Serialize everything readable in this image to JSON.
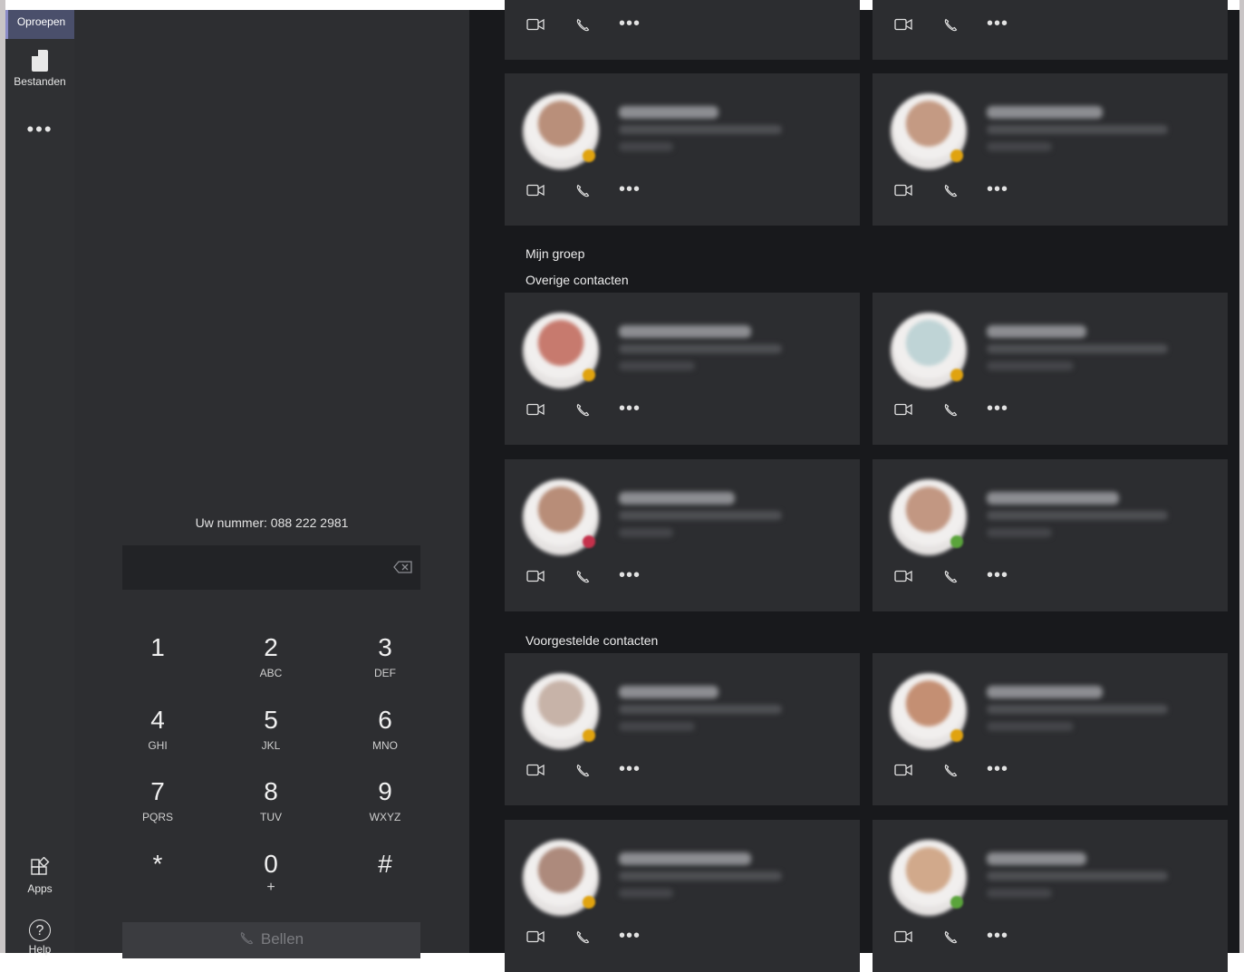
{
  "rail": {
    "calls_label": "Oproepen",
    "files_label": "Bestanden",
    "more_label": "•••",
    "apps_label": "Apps",
    "help_label": "Help"
  },
  "dialer": {
    "my_number_text": "Uw nummer: 088 222 2981",
    "input_value": "",
    "keys": [
      {
        "digit": "1",
        "letters": ""
      },
      {
        "digit": "2",
        "letters": "ABC"
      },
      {
        "digit": "3",
        "letters": "DEF"
      },
      {
        "digit": "4",
        "letters": "GHI"
      },
      {
        "digit": "5",
        "letters": "JKL"
      },
      {
        "digit": "6",
        "letters": "MNO"
      },
      {
        "digit": "7",
        "letters": "PQRS"
      },
      {
        "digit": "8",
        "letters": "TUV"
      },
      {
        "digit": "9",
        "letters": "WXYZ"
      },
      {
        "digit": "*",
        "letters": ""
      },
      {
        "digit": "0",
        "letters": "+"
      },
      {
        "digit": "#",
        "letters": ""
      }
    ],
    "call_label": "Bellen"
  },
  "sections": {
    "my_group": "Mijn groep",
    "other_contacts": "Overige contacten",
    "suggested_contacts": "Voorgestelde contacten"
  },
  "colors": {
    "rail_bg": "#2f3033",
    "dial_bg": "#2d2e31",
    "contacts_bg": "#18191c",
    "card_bg": "#2c2d30",
    "accent": "#4a4f6b",
    "presence_available": "#5aa43b",
    "presence_away": "#e0a30f",
    "presence_busy": "#c4314b"
  },
  "contact_cards": [
    {
      "presence": "away"
    },
    {
      "presence": "away"
    },
    {
      "presence": "away"
    },
    {
      "presence": "away"
    },
    {
      "presence": "busy"
    },
    {
      "presence": "available"
    },
    {
      "presence": "away"
    },
    {
      "presence": "away"
    },
    {
      "presence": "away"
    },
    {
      "presence": "available"
    },
    {
      "presence": "available"
    },
    {
      "presence": "busy"
    }
  ],
  "card_action_icons": [
    "video-camera-icon",
    "phone-icon",
    "more-options-icon"
  ]
}
